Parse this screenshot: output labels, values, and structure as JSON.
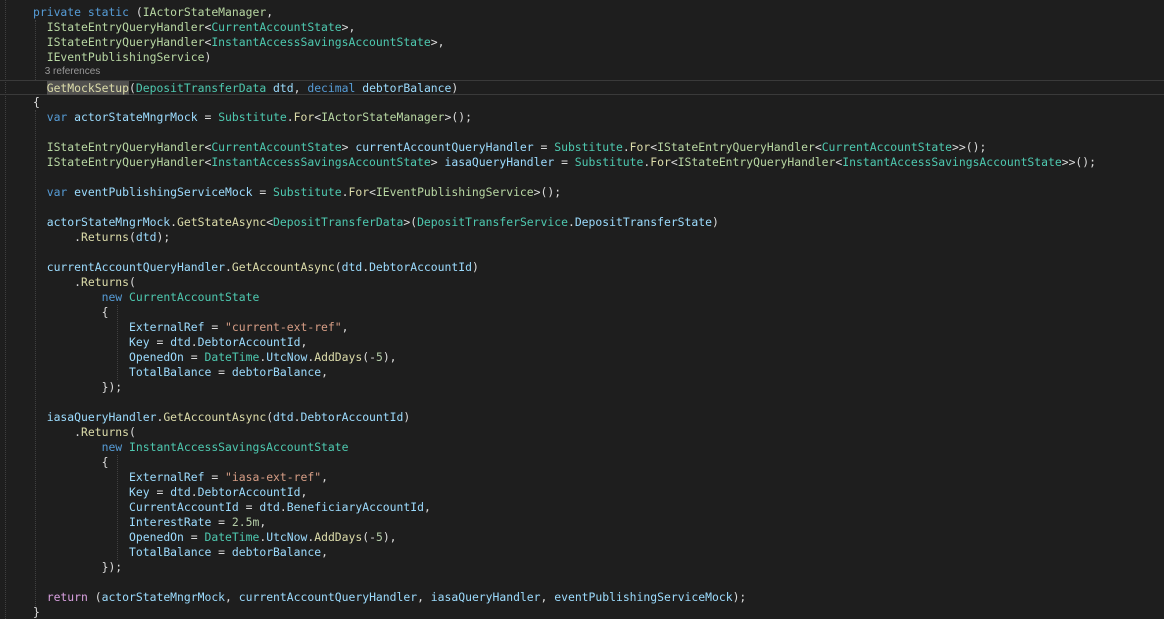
{
  "editor": {
    "background": "#1e1e1e",
    "colors": {
      "keyword": "#569cd6",
      "control_keyword": "#d8a0df",
      "type": "#4ec9b0",
      "interface": "#b8d7a3",
      "method": "#dcdcaa",
      "variable": "#9cdcfe",
      "string": "#d69d85",
      "number": "#b5cea8",
      "text": "#dcdcdc",
      "codelens": "#999999"
    },
    "lines": [
      {
        "indent": 2,
        "tokens": [
          [
            "kw",
            "private"
          ],
          [
            "p",
            " "
          ],
          [
            "kw",
            "static"
          ],
          [
            "p",
            " ("
          ],
          [
            "iface",
            "IActorStateManager"
          ],
          [
            "p",
            ","
          ]
        ]
      },
      {
        "indent": 4,
        "tokens": [
          [
            "iface",
            "IStateEntryQueryHandler"
          ],
          [
            "p",
            "<"
          ],
          [
            "type",
            "CurrentAccountState"
          ],
          [
            "p",
            ">,"
          ]
        ]
      },
      {
        "indent": 4,
        "tokens": [
          [
            "iface",
            "IStateEntryQueryHandler"
          ],
          [
            "p",
            "<"
          ],
          [
            "type",
            "InstantAccessSavingsAccountState"
          ],
          [
            "p",
            ">,"
          ]
        ]
      },
      {
        "indent": 4,
        "tokens": [
          [
            "iface",
            "IEventPublishingService"
          ],
          [
            "p",
            ")"
          ]
        ]
      },
      {
        "indent": 4,
        "codelens": true,
        "tokens": [
          [
            "lens",
            "3 references"
          ]
        ]
      },
      {
        "indent": 4,
        "highlight": true,
        "tokens": [
          [
            "sel",
            "GetMockSetup"
          ],
          [
            "p",
            "("
          ],
          [
            "type",
            "DepositTransferData"
          ],
          [
            "p",
            " "
          ],
          [
            "var",
            "dtd"
          ],
          [
            "p",
            ", "
          ],
          [
            "kw",
            "decimal"
          ],
          [
            "p",
            " "
          ],
          [
            "var",
            "debtorBalance"
          ],
          [
            "p",
            ")"
          ]
        ]
      },
      {
        "indent": 2,
        "tokens": [
          [
            "p",
            "{"
          ]
        ]
      },
      {
        "indent": 4,
        "tokens": [
          [
            "kw",
            "var"
          ],
          [
            "p",
            " "
          ],
          [
            "var",
            "actorStateMngrMock"
          ],
          [
            "p",
            " = "
          ],
          [
            "type",
            "Substitute"
          ],
          [
            "p",
            "."
          ],
          [
            "method",
            "For"
          ],
          [
            "p",
            "<"
          ],
          [
            "iface",
            "IActorStateManager"
          ],
          [
            "p",
            ">();"
          ]
        ]
      },
      {
        "indent": 0,
        "tokens": []
      },
      {
        "indent": 4,
        "tokens": [
          [
            "iface",
            "IStateEntryQueryHandler"
          ],
          [
            "p",
            "<"
          ],
          [
            "type",
            "CurrentAccountState"
          ],
          [
            "p",
            "> "
          ],
          [
            "var",
            "currentAccountQueryHandler"
          ],
          [
            "p",
            " = "
          ],
          [
            "type",
            "Substitute"
          ],
          [
            "p",
            "."
          ],
          [
            "method",
            "For"
          ],
          [
            "p",
            "<"
          ],
          [
            "iface",
            "IStateEntryQueryHandler"
          ],
          [
            "p",
            "<"
          ],
          [
            "type",
            "CurrentAccountState"
          ],
          [
            "p",
            ">>();"
          ]
        ]
      },
      {
        "indent": 4,
        "tokens": [
          [
            "iface",
            "IStateEntryQueryHandler"
          ],
          [
            "p",
            "<"
          ],
          [
            "type",
            "InstantAccessSavingsAccountState"
          ],
          [
            "p",
            "> "
          ],
          [
            "var",
            "iasaQueryHandler"
          ],
          [
            "p",
            " = "
          ],
          [
            "type",
            "Substitute"
          ],
          [
            "p",
            "."
          ],
          [
            "method",
            "For"
          ],
          [
            "p",
            "<"
          ],
          [
            "iface",
            "IStateEntryQueryHandler"
          ],
          [
            "p",
            "<"
          ],
          [
            "type",
            "InstantAccessSavingsAccountState"
          ],
          [
            "p",
            ">>();"
          ]
        ]
      },
      {
        "indent": 0,
        "tokens": []
      },
      {
        "indent": 4,
        "tokens": [
          [
            "kw",
            "var"
          ],
          [
            "p",
            " "
          ],
          [
            "var",
            "eventPublishingServiceMock"
          ],
          [
            "p",
            " = "
          ],
          [
            "type",
            "Substitute"
          ],
          [
            "p",
            "."
          ],
          [
            "method",
            "For"
          ],
          [
            "p",
            "<"
          ],
          [
            "iface",
            "IEventPublishingService"
          ],
          [
            "p",
            ">();"
          ]
        ]
      },
      {
        "indent": 0,
        "tokens": []
      },
      {
        "indent": 4,
        "tokens": [
          [
            "var",
            "actorStateMngrMock"
          ],
          [
            "p",
            "."
          ],
          [
            "method",
            "GetStateAsync"
          ],
          [
            "p",
            "<"
          ],
          [
            "type",
            "DepositTransferData"
          ],
          [
            "p",
            ">("
          ],
          [
            "type",
            "DepositTransferService"
          ],
          [
            "p",
            "."
          ],
          [
            "var",
            "DepositTransferState"
          ],
          [
            "p",
            ")"
          ]
        ]
      },
      {
        "indent": 8,
        "tokens": [
          [
            "p",
            "."
          ],
          [
            "method",
            "Returns"
          ],
          [
            "p",
            "("
          ],
          [
            "var",
            "dtd"
          ],
          [
            "p",
            ");"
          ]
        ]
      },
      {
        "indent": 0,
        "tokens": []
      },
      {
        "indent": 4,
        "tokens": [
          [
            "var",
            "currentAccountQueryHandler"
          ],
          [
            "p",
            "."
          ],
          [
            "method",
            "GetAccountAsync"
          ],
          [
            "p",
            "("
          ],
          [
            "var",
            "dtd"
          ],
          [
            "p",
            "."
          ],
          [
            "var",
            "DebtorAccountId"
          ],
          [
            "p",
            ")"
          ]
        ]
      },
      {
        "indent": 8,
        "tokens": [
          [
            "p",
            "."
          ],
          [
            "method",
            "Returns"
          ],
          [
            "p",
            "("
          ]
        ]
      },
      {
        "indent": 12,
        "tokens": [
          [
            "kw",
            "new"
          ],
          [
            "p",
            " "
          ],
          [
            "type",
            "CurrentAccountState"
          ]
        ]
      },
      {
        "indent": 12,
        "tokens": [
          [
            "p",
            "{"
          ]
        ]
      },
      {
        "indent": 16,
        "tokens": [
          [
            "var",
            "ExternalRef"
          ],
          [
            "p",
            " = "
          ],
          [
            "str",
            "\"current-ext-ref\""
          ],
          [
            "p",
            ","
          ]
        ]
      },
      {
        "indent": 16,
        "tokens": [
          [
            "var",
            "Key"
          ],
          [
            "p",
            " = "
          ],
          [
            "var",
            "dtd"
          ],
          [
            "p",
            "."
          ],
          [
            "var",
            "DebtorAccountId"
          ],
          [
            "p",
            ","
          ]
        ]
      },
      {
        "indent": 16,
        "tokens": [
          [
            "var",
            "OpenedOn"
          ],
          [
            "p",
            " = "
          ],
          [
            "type",
            "DateTime"
          ],
          [
            "p",
            "."
          ],
          [
            "var",
            "UtcNow"
          ],
          [
            "p",
            "."
          ],
          [
            "method",
            "AddDays"
          ],
          [
            "p",
            "(-"
          ],
          [
            "num",
            "5"
          ],
          [
            "p",
            "),"
          ]
        ]
      },
      {
        "indent": 16,
        "tokens": [
          [
            "var",
            "TotalBalance"
          ],
          [
            "p",
            " = "
          ],
          [
            "var",
            "debtorBalance"
          ],
          [
            "p",
            ","
          ]
        ]
      },
      {
        "indent": 12,
        "tokens": [
          [
            "p",
            "});"
          ]
        ]
      },
      {
        "indent": 0,
        "tokens": []
      },
      {
        "indent": 4,
        "tokens": [
          [
            "var",
            "iasaQueryHandler"
          ],
          [
            "p",
            "."
          ],
          [
            "method",
            "GetAccountAsync"
          ],
          [
            "p",
            "("
          ],
          [
            "var",
            "dtd"
          ],
          [
            "p",
            "."
          ],
          [
            "var",
            "DebtorAccountId"
          ],
          [
            "p",
            ")"
          ]
        ]
      },
      {
        "indent": 8,
        "tokens": [
          [
            "p",
            "."
          ],
          [
            "method",
            "Returns"
          ],
          [
            "p",
            "("
          ]
        ]
      },
      {
        "indent": 12,
        "tokens": [
          [
            "kw",
            "new"
          ],
          [
            "p",
            " "
          ],
          [
            "type",
            "InstantAccessSavingsAccountState"
          ]
        ]
      },
      {
        "indent": 12,
        "tokens": [
          [
            "p",
            "{"
          ]
        ]
      },
      {
        "indent": 16,
        "tokens": [
          [
            "var",
            "ExternalRef"
          ],
          [
            "p",
            " = "
          ],
          [
            "str",
            "\"iasa-ext-ref\""
          ],
          [
            "p",
            ","
          ]
        ]
      },
      {
        "indent": 16,
        "tokens": [
          [
            "var",
            "Key"
          ],
          [
            "p",
            " = "
          ],
          [
            "var",
            "dtd"
          ],
          [
            "p",
            "."
          ],
          [
            "var",
            "DebtorAccountId"
          ],
          [
            "p",
            ","
          ]
        ]
      },
      {
        "indent": 16,
        "tokens": [
          [
            "var",
            "CurrentAccountId"
          ],
          [
            "p",
            " = "
          ],
          [
            "var",
            "dtd"
          ],
          [
            "p",
            "."
          ],
          [
            "var",
            "BeneficiaryAccountId"
          ],
          [
            "p",
            ","
          ]
        ]
      },
      {
        "indent": 16,
        "tokens": [
          [
            "var",
            "InterestRate"
          ],
          [
            "p",
            " = "
          ],
          [
            "num",
            "2.5m"
          ],
          [
            "p",
            ","
          ]
        ]
      },
      {
        "indent": 16,
        "tokens": [
          [
            "var",
            "OpenedOn"
          ],
          [
            "p",
            " = "
          ],
          [
            "type",
            "DateTime"
          ],
          [
            "p",
            "."
          ],
          [
            "var",
            "UtcNow"
          ],
          [
            "p",
            "."
          ],
          [
            "method",
            "AddDays"
          ],
          [
            "p",
            "(-"
          ],
          [
            "num",
            "5"
          ],
          [
            "p",
            "),"
          ]
        ]
      },
      {
        "indent": 16,
        "tokens": [
          [
            "var",
            "TotalBalance"
          ],
          [
            "p",
            " = "
          ],
          [
            "var",
            "debtorBalance"
          ],
          [
            "p",
            ","
          ]
        ]
      },
      {
        "indent": 12,
        "tokens": [
          [
            "p",
            "});"
          ]
        ]
      },
      {
        "indent": 0,
        "tokens": []
      },
      {
        "indent": 4,
        "tokens": [
          [
            "ctl",
            "return"
          ],
          [
            "p",
            " ("
          ],
          [
            "var",
            "actorStateMngrMock"
          ],
          [
            "p",
            ", "
          ],
          [
            "var",
            "currentAccountQueryHandler"
          ],
          [
            "p",
            ", "
          ],
          [
            "var",
            "iasaQueryHandler"
          ],
          [
            "p",
            ", "
          ],
          [
            "var",
            "eventPublishingServiceMock"
          ],
          [
            "p",
            ");"
          ]
        ]
      },
      {
        "indent": 2,
        "tokens": [
          [
            "p",
            "}"
          ]
        ]
      }
    ]
  }
}
